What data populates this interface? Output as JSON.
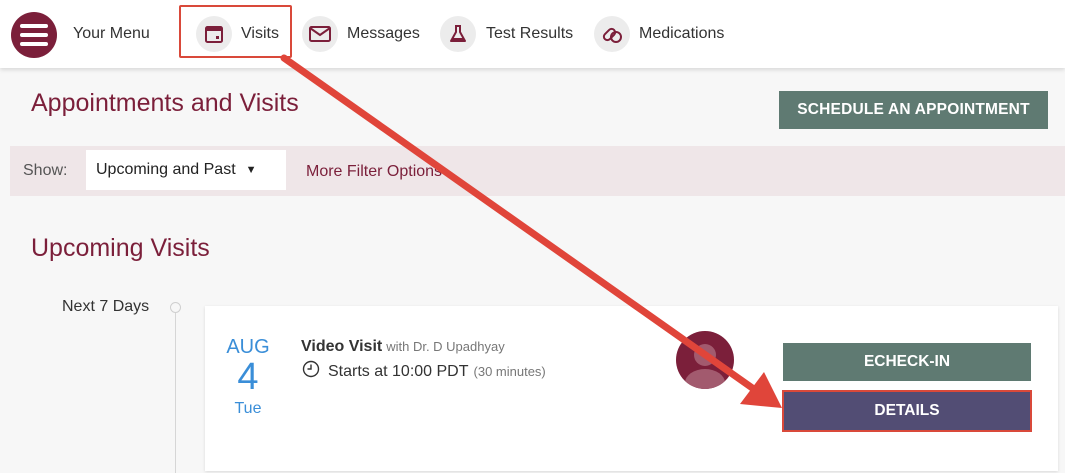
{
  "topnav": {
    "menu_label": "Your Menu",
    "items": [
      {
        "label": "Visits",
        "icon": "calendar-icon"
      },
      {
        "label": "Messages",
        "icon": "envelope-icon"
      },
      {
        "label": "Test Results",
        "icon": "flask-icon"
      },
      {
        "label": "Medications",
        "icon": "pills-icon"
      }
    ]
  },
  "header": {
    "title": "Appointments and Visits",
    "schedule_button": "SCHEDULE AN APPOINTMENT"
  },
  "filter": {
    "show_label": "Show:",
    "selected": "Upcoming and Past",
    "more_filters": "More Filter Options"
  },
  "upcoming": {
    "title": "Upcoming Visits",
    "timeline_label": "Next 7 Days",
    "visit": {
      "month": "AUG",
      "day": "4",
      "weekday": "Tue",
      "type": "Video Visit",
      "with": "with Dr. D Upadhyay",
      "time": "Starts at 10:00 PDT",
      "duration": "(30 minutes)",
      "echeck_button": "ECHECK-IN",
      "details_button": "DETAILS"
    }
  },
  "colors": {
    "brand": "#7b1f3a",
    "button_green": "#5f7a72",
    "button_purple": "#524d74",
    "highlight_red": "#d9493a",
    "date_blue": "#3a8ed8"
  }
}
